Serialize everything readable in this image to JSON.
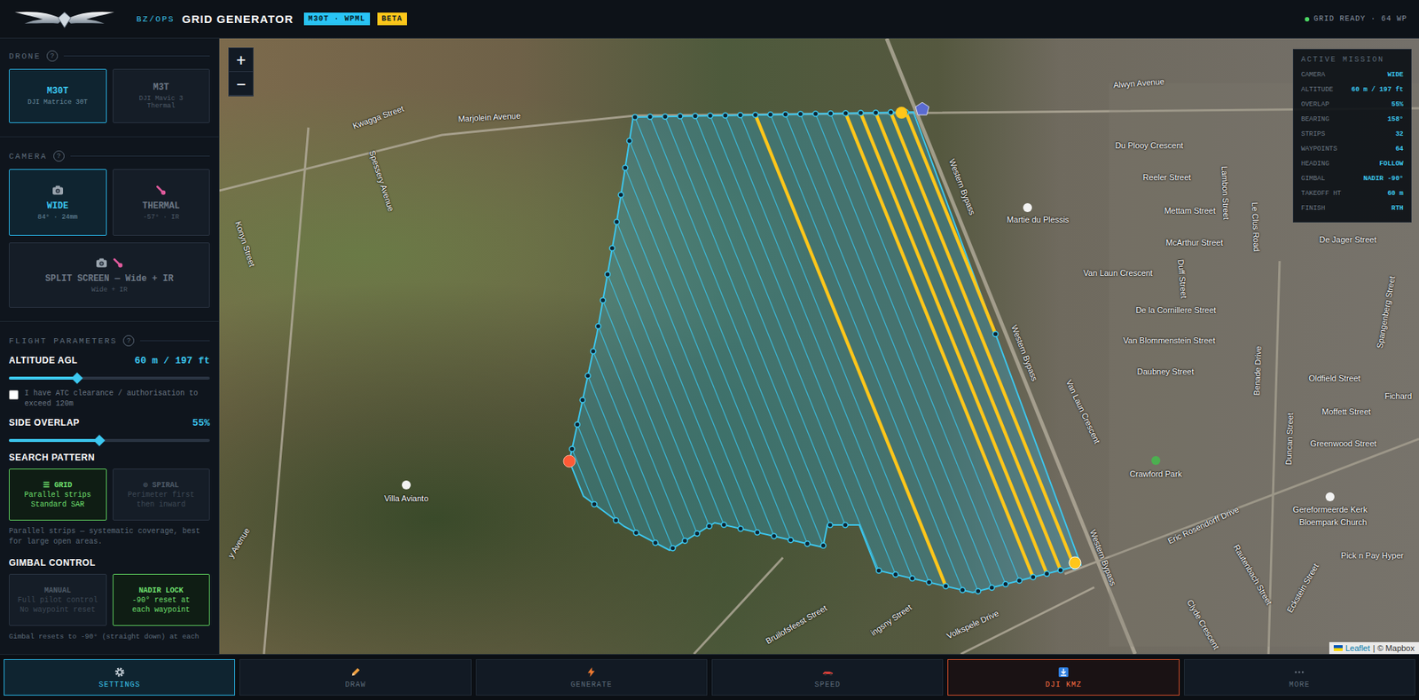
{
  "header": {
    "org": "BZ/OPS",
    "title": "GRID GENERATOR",
    "badges": [
      {
        "label": "M30T · WPML",
        "color": "#29c4f5"
      },
      {
        "label": "BETA",
        "color": "#ffc61a"
      }
    ],
    "status": "GRID READY · 64 WP"
  },
  "sidebar": {
    "drone": {
      "heading": "DRONE",
      "help": "?",
      "options": [
        {
          "name": "M30T",
          "detail": "DJI Matrice 30T",
          "selected": true
        },
        {
          "name": "M3T",
          "detail": "DJI Mavic 3 Thermal",
          "selected": false
        }
      ]
    },
    "camera": {
      "heading": "CAMERA",
      "help": "?",
      "options": [
        {
          "name": "WIDE",
          "detail": "84° · 24mm",
          "kind": "wide",
          "selected": true
        },
        {
          "name": "THERMAL",
          "detail": "-57° · IR",
          "kind": "thermal",
          "selected": false
        },
        {
          "name": "SPLIT SCREEN — Wide + IR",
          "detail": "Wide + IR",
          "kind": "split",
          "selected": false
        }
      ]
    },
    "flight": {
      "heading": "FLIGHT PARAMETERS",
      "help": "?",
      "altitude": {
        "label": "ALTITUDE AGL",
        "reading": "60 m / 197 ft",
        "level": 0.34
      },
      "atc": {
        "label": "I have ATC clearance / authorisation to exceed 120m",
        "checked": false
      },
      "overlap": {
        "label": "SIDE OVERLAP",
        "reading": "55%",
        "level": 0.45
      }
    },
    "pattern": {
      "heading": "SEARCH PATTERN",
      "options": [
        {
          "glyph": "☰",
          "name": "GRID",
          "lines": [
            "Parallel strips",
            "Standard SAR"
          ],
          "selected": true
        },
        {
          "glyph": "⊙",
          "name": "SPIRAL",
          "lines": [
            "Perimeter first",
            "then inward"
          ],
          "selected": false
        }
      ],
      "description": "Parallel strips — systematic coverage, best for large open areas."
    },
    "gimbal": {
      "heading": "GIMBAL CONTROL",
      "options": [
        {
          "name": "MANUAL",
          "lines": [
            "Full pilot control",
            "No waypoint reset"
          ],
          "selected": false
        },
        {
          "name": "NADIR LOCK",
          "lines": [
            "-90° reset at",
            "each waypoint"
          ],
          "selected": true
        }
      ],
      "note": "Gimbal resets to -90° (straight down) at each"
    }
  },
  "map": {
    "zoom": [
      "+",
      "−"
    ],
    "labels": [
      "Kwagga Street",
      "Marjolein Avenue",
      "Spessery Avenue",
      "Konyn Street",
      "Villa Avianto",
      "y Avenue",
      "Alwyn Avenue",
      "Du Plooy Crescent",
      "Reeler Street",
      "Mettam Street",
      "McArthur Street",
      "Van Laun Crescent",
      "De la Cornillere Street",
      "Van Blommenstein Street",
      "Daubney Street",
      "Western Bypass",
      "Western Bypass",
      "Western Bypass",
      "Martie du Plessis",
      "Van Laun Crescent",
      "Duff Street",
      "Lambon Street",
      "Le Clus Road",
      "Benade Drive",
      "De Jager Street",
      "Oldfield Street",
      "Moffett Street",
      "Greenwood Street",
      "Spangenberg Street",
      "Duncan Street",
      "Crawford Park",
      "Eric Rosendorff Drive",
      "Gereformeerde Kerk",
      "Bloempark Church",
      "Pick n Pay Hyper",
      "Rautenbach Street",
      "Eckstein Street",
      "Clyde Crescent",
      "Volkspele Drive",
      "Bruilofsfeest Street",
      "ingsny Street",
      "Fichard"
    ],
    "attribution": {
      "link": "Leaflet",
      "rest": "| © Mapbox"
    },
    "flight_lines": [
      {
        "highlighted": false
      },
      {
        "highlighted": false
      },
      {
        "highlighted": false
      },
      {
        "highlighted": false
      },
      {
        "highlighted": false
      },
      {
        "highlighted": false
      },
      {
        "highlighted": false
      },
      {
        "highlighted": false
      },
      {
        "highlighted": false
      },
      {
        "highlighted": false
      },
      {
        "highlighted": false
      },
      {
        "highlighted": false
      },
      {
        "highlighted": false
      },
      {
        "highlighted": false
      },
      {
        "highlighted": false
      },
      {
        "highlighted": false
      },
      {
        "highlighted": false
      },
      {
        "highlighted": false
      },
      {
        "highlighted": false
      },
      {
        "highlighted": false
      },
      {
        "highlighted": false
      },
      {
        "highlighted": true
      },
      {
        "highlighted": false
      },
      {
        "highlighted": false
      },
      {
        "highlighted": false
      },
      {
        "highlighted": false
      },
      {
        "highlighted": false
      },
      {
        "highlighted": true
      },
      {
        "highlighted": true
      },
      {
        "highlighted": true
      },
      {
        "highlighted": true
      },
      {
        "highlighted": true
      }
    ],
    "mission": {
      "title": "ACTIVE MISSION",
      "rows": [
        {
          "label": "CAMERA",
          "value": "WIDE"
        },
        {
          "label": "ALTITUDE",
          "value": "60 m / 197 ft"
        },
        {
          "label": "OVERLAP",
          "value": "55%"
        },
        {
          "label": "BEARING",
          "value": "158°"
        },
        {
          "label": "STRIPS",
          "value": "32"
        },
        {
          "label": "WAYPOINTS",
          "value": "64"
        },
        {
          "label": "HEADING",
          "value": "FOLLOW"
        },
        {
          "label": "GIMBAL",
          "value": "NADIR -90°"
        },
        {
          "label": "TAKEOFF HT",
          "value": "60 m"
        },
        {
          "label": "FINISH",
          "value": "RTH"
        }
      ]
    }
  },
  "toolbar": [
    {
      "label": "SETTINGS",
      "kind": "nav",
      "selected": true
    },
    {
      "label": "DRAW",
      "kind": "nav",
      "selected": false
    },
    {
      "label": "GENERATE",
      "kind": "nav",
      "selected": false
    },
    {
      "label": "SPEED",
      "kind": "nav",
      "selected": false
    },
    {
      "label": "DJI KMZ",
      "kind": "action",
      "selected": false
    },
    {
      "label": "MORE",
      "kind": "nav",
      "selected": false
    }
  ]
}
